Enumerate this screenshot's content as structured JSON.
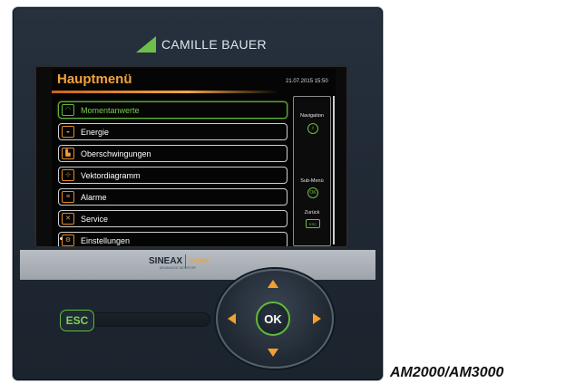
{
  "device": {
    "brand": "CAMILLE BAUER",
    "screen": {
      "title": "Hauptmenü",
      "datetime": "21.07.2015 15:50",
      "menu": [
        {
          "label": "Momentanwerte",
          "icon": "gauge-icon",
          "active": true
        },
        {
          "label": "Energie",
          "icon": "energy-meter-icon",
          "active": false
        },
        {
          "label": "Oberschwingungen",
          "icon": "harmonics-bars-icon",
          "active": false
        },
        {
          "label": "Vektordiagramm",
          "icon": "vector-diagram-icon",
          "active": false
        },
        {
          "label": "Alarme",
          "icon": "alarm-list-icon",
          "active": false
        },
        {
          "label": "Service",
          "icon": "tools-icon",
          "active": false
        },
        {
          "label": "Einstellungen",
          "icon": "settings-icon",
          "active": false
        }
      ],
      "side": {
        "navigation_label": "Navigation",
        "submenu_label": "Sub-Menü",
        "submenu_key": "OK",
        "back_label": "Zurück",
        "back_key": "ESC"
      }
    },
    "logo": {
      "main": "SINEAX",
      "model": "AM3000",
      "sub1": "ADVANCED",
      "sub2": "MONITOR"
    },
    "controls": {
      "esc": "ESC",
      "ok": "OK"
    }
  },
  "caption": "AM2000/AM3000",
  "colors": {
    "accent_orange": "#f2a12f",
    "accent_green": "#66b53a",
    "housing": "#222b36"
  }
}
